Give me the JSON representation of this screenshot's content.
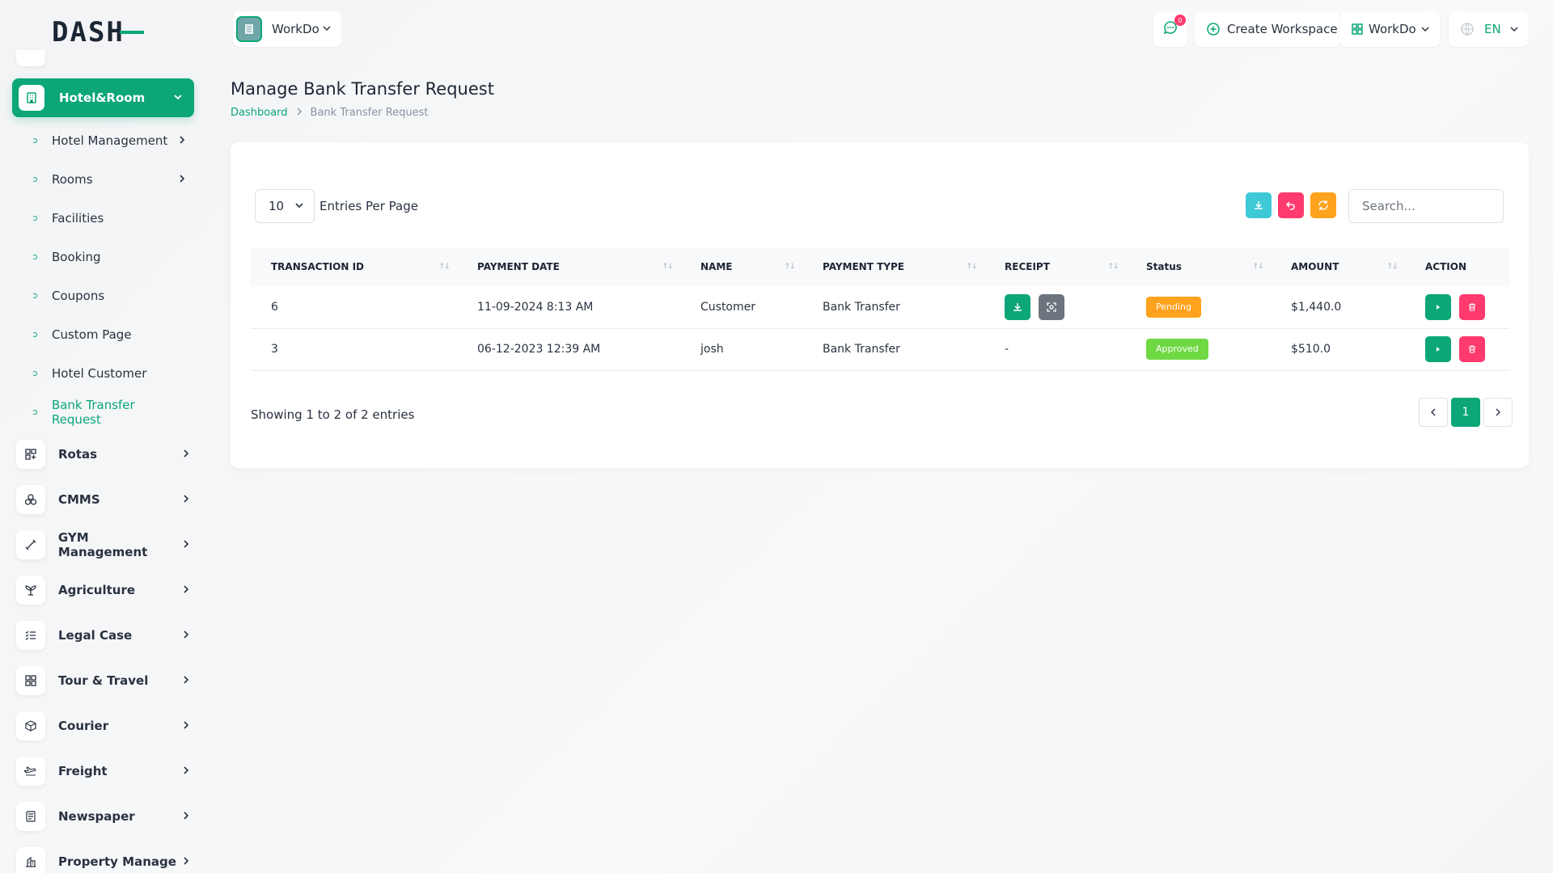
{
  "brand": {
    "logo_text": "DASH"
  },
  "sidebar": {
    "active_group": {
      "label": "Hotel&Room"
    },
    "sub_items": [
      {
        "label": "Hotel Management",
        "has_children": true
      },
      {
        "label": "Rooms",
        "has_children": true
      },
      {
        "label": "Facilities",
        "has_children": false
      },
      {
        "label": "Booking",
        "has_children": false
      },
      {
        "label": "Coupons",
        "has_children": false
      },
      {
        "label": "Custom Page",
        "has_children": false
      },
      {
        "label": "Hotel Customer",
        "has_children": false
      },
      {
        "label": "Bank Transfer Request",
        "has_children": false,
        "active": true
      }
    ],
    "items": [
      {
        "label": "Rotas",
        "icon": "grid-icon"
      },
      {
        "label": "CMMS",
        "icon": "circles-icon"
      },
      {
        "label": "GYM Management",
        "icon": "dumbbell-icon"
      },
      {
        "label": "Agriculture",
        "icon": "plant-icon"
      },
      {
        "label": "Legal Case",
        "icon": "list-check-icon"
      },
      {
        "label": "Tour & Travel",
        "icon": "grid-plus-icon"
      },
      {
        "label": "Courier",
        "icon": "box-icon"
      },
      {
        "label": "Freight",
        "icon": "plane-icon"
      },
      {
        "label": "Newspaper",
        "icon": "newspaper-icon"
      },
      {
        "label": "Property Manage",
        "icon": "building-icon"
      }
    ]
  },
  "header": {
    "workspace_label": "WorkDo",
    "notification_count": "0",
    "create_workspace_label": "Create Workspace",
    "workspace_switch_label": "WorkDo",
    "language_label": "EN"
  },
  "page": {
    "title": "Manage Bank Transfer Request",
    "breadcrumb": {
      "home": "Dashboard",
      "current": "Bank Transfer Request"
    }
  },
  "table_controls": {
    "entries_value": "10",
    "entries_label": "Entries Per Page",
    "search_placeholder": "Search..."
  },
  "table": {
    "columns": [
      "TRANSACTION ID",
      "PAYMENT DATE",
      "NAME",
      "PAYMENT TYPE",
      "RECEIPT",
      "Status",
      "AMOUNT",
      "ACTION"
    ],
    "rows": [
      {
        "id": "6",
        "date": "11-09-2024 8:13 AM",
        "name": "Customer",
        "type": "Bank Transfer",
        "receipt": "",
        "status": "Pending",
        "status_color": "#ffa21d",
        "amount": "$1,440.0"
      },
      {
        "id": "3",
        "date": "06-12-2023 12:39 AM",
        "name": "josh",
        "type": "Bank Transfer",
        "receipt": "-",
        "status": "Approved",
        "status_color": "#6fd943",
        "amount": "$510.0"
      }
    ]
  },
  "footer": {
    "showing_text": "Showing 1 to 2 of 2 entries",
    "current_page": "1"
  },
  "colors": {
    "primary": "#0ca678",
    "info": "#3ec9d6",
    "danger": "#ff3a6e",
    "warning": "#ffa21d",
    "success": "#6fd943",
    "secondary": "#6c757d"
  }
}
